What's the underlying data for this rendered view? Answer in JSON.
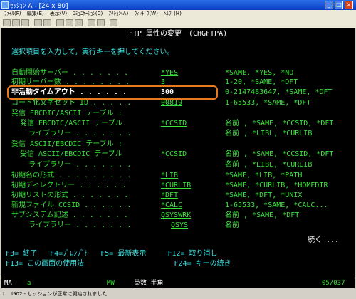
{
  "window": {
    "title": "ｾｯｼｮﾝ A - [24 x 80]"
  },
  "menu": [
    "ﾌｧｲﾙ(F)",
    "編集(E)",
    "表示(V)",
    "ｺﾐｭﾆｹｰｼｮﾝ(C)",
    "ｱｸｼｮﾝ(A)",
    "ｳｨﾝﾄﾞｳ(W)",
    "ﾍﾙﾌﾟ(H)"
  ],
  "screen": {
    "title": "FTP 属性の変更　(CHGFTPA)",
    "instruction": "選択項目を入力して，実行キーを押してください。",
    "fields": [
      {
        "label": "自動開始サーバー . . . . . . .",
        "value": "*YES",
        "options": "*SAME, *YES, *NO"
      },
      {
        "label": "初期サーバー数 . . . . . . . .",
        "value": "3",
        "options": "1-20, *SAME, *DFT"
      },
      {
        "label": "非活動タイムアウト . . . . . .",
        "value": "300",
        "options": "0-2147483647, *SAME, *DFT"
      },
      {
        "label": "コード化文字セット ID . . . . .",
        "value": "00819",
        "options": "1-65533, *SAME, *DFT"
      },
      {
        "label": "発信 EBCDIC/ASCII テーブル :",
        "value": "",
        "options": ""
      },
      {
        "label": "  発信 EBCDIC/ASCII テーブル",
        "value": "*CCSID",
        "options": "名前 , *SAME, *CCSID, *DFT"
      },
      {
        "label": "    ライブラリー . . . . . . .",
        "value": "",
        "options": "名前 , *LIBL, *CURLIB"
      },
      {
        "label": "受信 ASCII/EBCDIC テーブル :",
        "value": "",
        "options": ""
      },
      {
        "label": "  受信 ASCII/EBCDIC テーブル",
        "value": "*CCSID",
        "options": "名前 , *SAME, *CCSID, *DFT"
      },
      {
        "label": "    ライブラリー . . . . . . .",
        "value": "",
        "options": "名前 , *LIBL, *CURLIB"
      },
      {
        "label": "初期名の形式 . . . . . . . . .",
        "value": "*LIB",
        "options": "*SAME, *LIB, *PATH"
      },
      {
        "label": "初期ディレクトリー . . . . . .",
        "value": "*CURLIB",
        "options": "*SAME, *CURLIB, *HOMEDIR"
      },
      {
        "label": "初期リストの形式 . . . . . . .",
        "value": "*DFT",
        "options": "*SAME, *DFT, *UNIX"
      },
      {
        "label": "新規ファイル CCSID . . . . . .",
        "value": "*CALC",
        "options": "1-65533, *SAME, *CALC..."
      },
      {
        "label": "サブシステム記述 . . . . . . .",
        "value": "QSYSWRK",
        "options": "名前 , *SAME, *DFT"
      },
      {
        "label": "    ライブラリー . . . . . . .",
        "value": "QSYS",
        "options": "名前"
      }
    ],
    "more": "続く ...",
    "fkeys_line1": "F3= 終了   F4=ﾌﾟﾛﾝﾌﾟﾄ   F5= 最新表示     F12= 取り消し",
    "fkeys_line2": "F13= この画面の使用法                     F24= キーの続き"
  },
  "status": {
    "ma": "MA",
    "a": "a",
    "mw": "MW",
    "ime": "英数 半角",
    "cursor": "05/037"
  },
  "message": "I902 - セッションが正常に開始されました",
  "colors": {
    "cyan": "#36e2e2",
    "green": "#39e339",
    "white": "#ffffff",
    "highlight": "#e87a1e"
  }
}
